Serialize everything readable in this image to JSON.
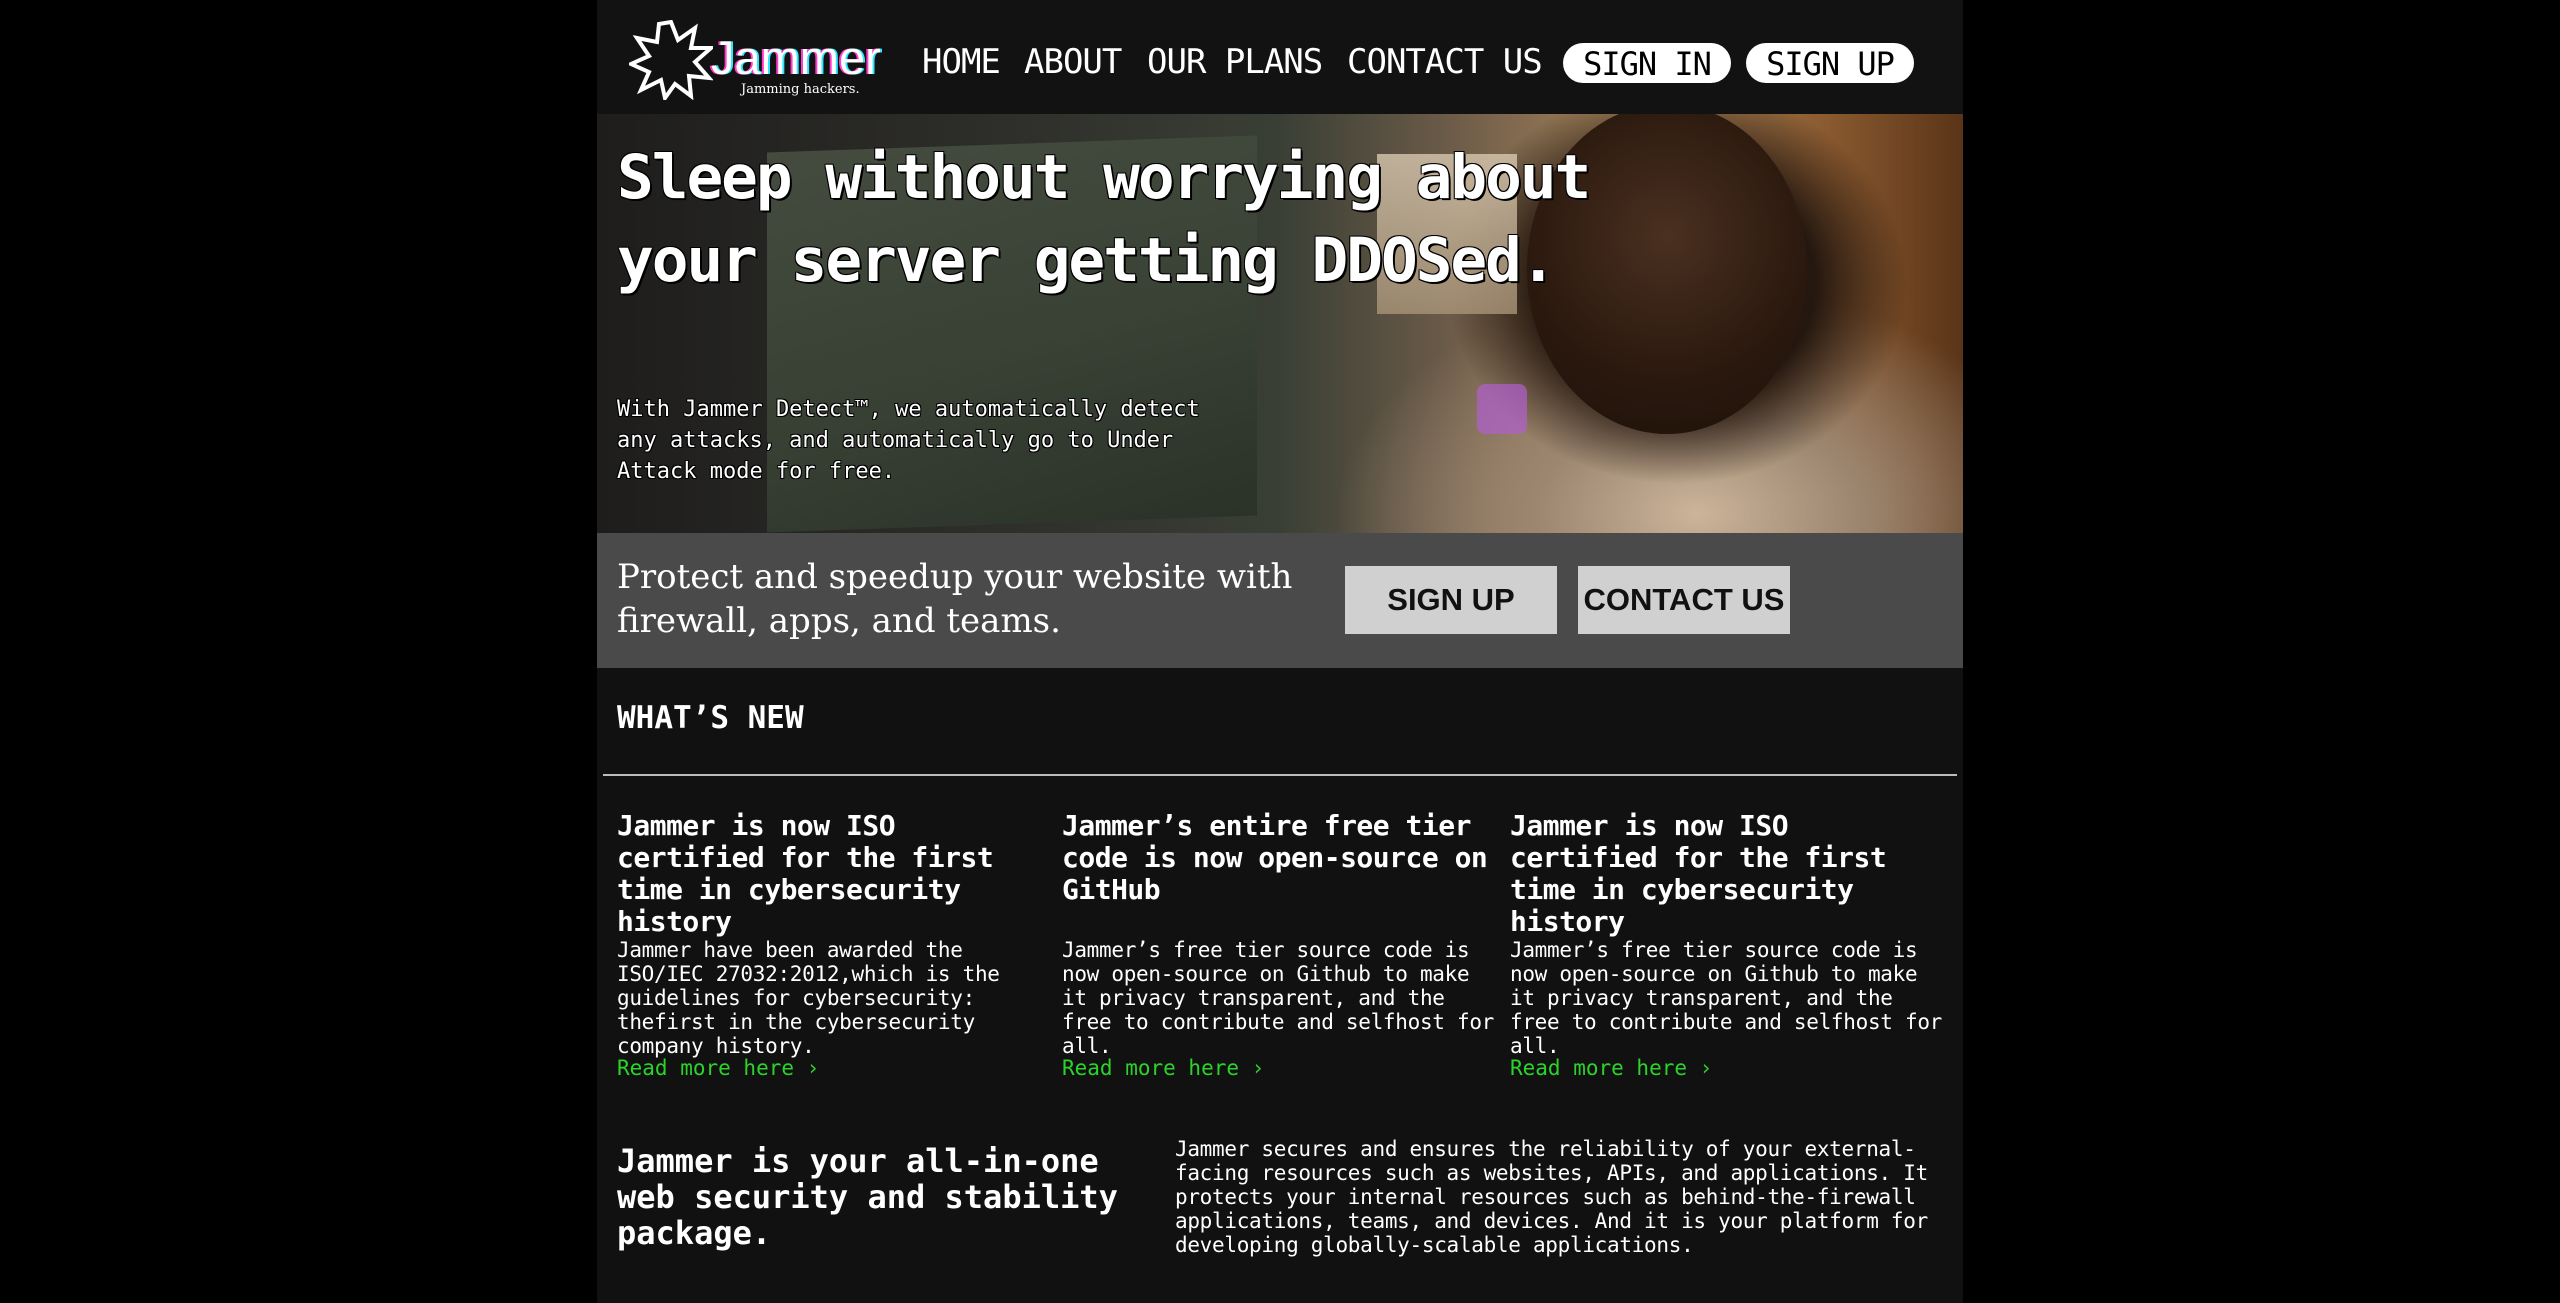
{
  "nav": {
    "logo_word": "Jammer",
    "logo_tagline": "Jamming hackers.",
    "links": [
      "HOME",
      "ABOUT",
      "OUR PLANS",
      "CONTACT US"
    ],
    "sign_in": "SIGN IN",
    "sign_up": "SIGN UP"
  },
  "hero": {
    "headline": "Sleep without worrying about your server getting DDOSed.",
    "subtext": "With Jammer Detect™, we automatically detect any attacks, and automatically go to Under Attack mode for free."
  },
  "cta": {
    "text": "Protect and speedup your website with firewall, apps, and teams.",
    "sign_up": "SIGN UP",
    "contact_us": "CONTACT US"
  },
  "whats_new": {
    "title": "WHAT’S NEW",
    "items": [
      {
        "title": "Jammer is now ISO certified for the first time in cybersecurity history",
        "body": "Jammer have been awarded the ISO/IEC 27032:2012,which is the guidelines for cybersecurity: thefirst in the cybersecurity company history.",
        "link": "Read more here ›"
      },
      {
        "title": "Jammer’s entire free tier code is now  open-source on GitHub",
        "body": "Jammer’s free tier source code is now open-source on Github to make it privacy transparent, and the free to contribute and selfhost for all.",
        "link": "Read more here ›"
      },
      {
        "title": "Jammer is now ISO certified for the first time in cybersecurity history",
        "body": "Jammer’s free tier source code is now open-source on Github to make it privacy transparent, and the free to contribute and selfhost for all.",
        "link": "Read more here ›"
      }
    ]
  },
  "pitch": {
    "title": "Jammer is your all-in-one web security and stability package.",
    "body": "Jammer secures and ensures the reliability of your external-facing resources such as websites, APIs, and applications. It protects your internal resources such as behind-the-firewall applications, teams, and devices. And it is your platform for developing globally-scalable applications."
  },
  "colors": {
    "background": "#000000",
    "page": "#111111",
    "cta_band": "#4a4a4a",
    "link_green": "#2bd32b",
    "logo_pink": "#ff3cc8",
    "logo_cyan": "#2ee6ff"
  }
}
